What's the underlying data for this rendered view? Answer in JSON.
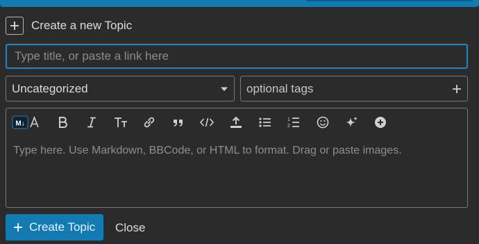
{
  "header": {
    "title": "Create a new Topic"
  },
  "title_input": {
    "placeholder": "Type title, or paste a link here",
    "value": ""
  },
  "category": {
    "selected": "Uncategorized"
  },
  "tags": {
    "placeholder": "optional tags"
  },
  "editor": {
    "placeholder": "Type here. Use Markdown, BBCode, or HTML to format. Drag or paste images.",
    "toolbar": [
      "markdown-toggle-icon",
      "bold-icon",
      "italic-icon",
      "heading-icon",
      "link-icon",
      "quote-icon",
      "code-icon",
      "upload-icon",
      "bullet-list-icon",
      "numbered-list-icon",
      "emoji-icon",
      "ai-sparkle-icon",
      "more-options-icon"
    ]
  },
  "footer": {
    "create_label": "Create Topic",
    "close_label": "Close"
  },
  "colors": {
    "accent": "#127ab2",
    "focus_border": "#1c89c4",
    "background": "#2b2b2b"
  }
}
